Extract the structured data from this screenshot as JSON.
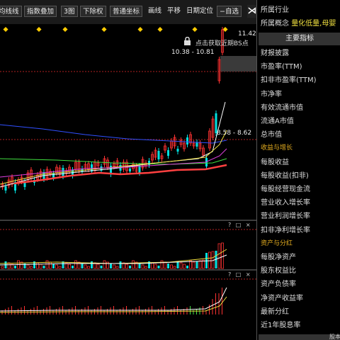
{
  "toolbar": {
    "buttons": [
      {
        "label": "均线线"
      },
      {
        "label": "指数叠加"
      },
      {
        "label": "3图"
      },
      {
        "label": "下除权"
      },
      {
        "label": "普通坐标"
      }
    ],
    "text_items": [
      "画线",
      "平移",
      "日期定位"
    ],
    "watchlist_label": "自选",
    "pin_icon": "pin-icon"
  },
  "chart": {
    "price_high_label": "11.42",
    "range_top": "10.38 - 10.81",
    "range_mid": "8.58 - 8.62",
    "bs_hint": "点击获取近期BS点",
    "lock_icon": "lock-icon",
    "panel_controls": "? □ ×",
    "colors": {
      "up": "#ff3232",
      "down": "#00e0e0",
      "ma_white": "#ffffff",
      "ma_yellow": "#f0e040",
      "ma_purple": "#e040e0",
      "ma_green": "#40e040",
      "ma_blue": "#3050ff",
      "ma_red": "#ff4040",
      "grid_dash": "#b02020",
      "marker": "#ffcc00"
    }
  },
  "sidebar": {
    "industry_label": "所属行业",
    "concept_label": "所属概念",
    "concept_value": "量化低量,母婴",
    "main_button": "主要指标",
    "rows": [
      {
        "label": "财报披露",
        "section": false
      },
      {
        "label": "市盈率(TTM)",
        "section": false
      },
      {
        "label": "扣非市盈率(TTM)",
        "section": false
      },
      {
        "label": "市净率",
        "section": false
      },
      {
        "label": "有效流通市值",
        "section": false
      },
      {
        "label": "流通A市值",
        "section": false
      },
      {
        "label": "总市值",
        "section": false
      },
      {
        "label": "收益与增长",
        "section": true
      },
      {
        "label": "每股收益",
        "section": false
      },
      {
        "label": "每股收益(扣非)",
        "section": false
      },
      {
        "label": "每股经营现金流",
        "section": false
      },
      {
        "label": "营业收入增长率",
        "section": false
      },
      {
        "label": "营业利润增长率",
        "section": false
      },
      {
        "label": "扣非净利增长率",
        "section": false
      },
      {
        "label": "资产与分红",
        "section": true
      },
      {
        "label": "每股净资产",
        "section": false
      },
      {
        "label": "股东权益比",
        "section": false
      },
      {
        "label": "资产负债率",
        "section": false
      },
      {
        "label": "净资产收益率",
        "section": false
      },
      {
        "label": "最新分红",
        "section": false
      },
      {
        "label": "近1年股息率",
        "section": false
      }
    ],
    "bottom_label": "股本"
  }
}
